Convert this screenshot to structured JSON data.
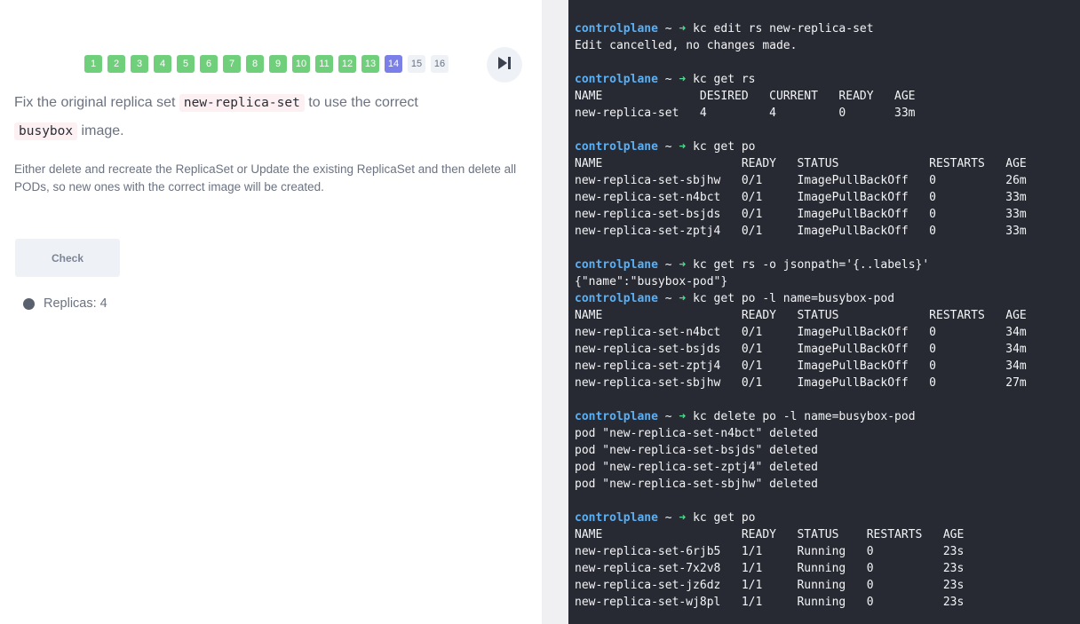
{
  "steps": [
    {
      "label": "1",
      "state": "done"
    },
    {
      "label": "2",
      "state": "done"
    },
    {
      "label": "3",
      "state": "done"
    },
    {
      "label": "4",
      "state": "done"
    },
    {
      "label": "5",
      "state": "done"
    },
    {
      "label": "6",
      "state": "done"
    },
    {
      "label": "7",
      "state": "done"
    },
    {
      "label": "8",
      "state": "done"
    },
    {
      "label": "9",
      "state": "done"
    },
    {
      "label": "10",
      "state": "done"
    },
    {
      "label": "11",
      "state": "done"
    },
    {
      "label": "12",
      "state": "done"
    },
    {
      "label": "13",
      "state": "done"
    },
    {
      "label": "14",
      "state": "current"
    },
    {
      "label": "15",
      "state": "todo"
    },
    {
      "label": "16",
      "state": "todo"
    }
  ],
  "question": {
    "p1_before": "Fix the original replica set ",
    "p1_code1": "new-replica-set",
    "p1_middle": " to use the correct ",
    "p1_code2": "busybox",
    "p1_after": " image.",
    "p2": "Either delete and recreate the ReplicaSet or Update the existing ReplicaSet and then delete all PODs, so new ones with the correct image will be created."
  },
  "check_label": "Check",
  "status": {
    "label": "Replicas: 4"
  },
  "colors": {
    "done": "#6fcf7b",
    "current": "#7b7fe8",
    "terminal_bg": "#272a33",
    "prompt": "#5ab0f5",
    "arrow": "#48e08a"
  },
  "terminal": {
    "lines": [
      {
        "type": "cmd",
        "prompt": "controlplane",
        "cmd": "kc edit rs new-replica-set"
      },
      {
        "type": "out",
        "text": "Edit cancelled, no changes made."
      },
      {
        "type": "blank"
      },
      {
        "type": "cmd",
        "prompt": "controlplane",
        "cmd": "kc get rs"
      },
      {
        "type": "out",
        "text": "NAME              DESIRED   CURRENT   READY   AGE"
      },
      {
        "type": "out",
        "text": "new-replica-set   4         4         0       33m"
      },
      {
        "type": "blank"
      },
      {
        "type": "cmd",
        "prompt": "controlplane",
        "cmd": "kc get po"
      },
      {
        "type": "out",
        "text": "NAME                    READY   STATUS             RESTARTS   AGE"
      },
      {
        "type": "out",
        "text": "new-replica-set-sbjhw   0/1     ImagePullBackOff   0          26m"
      },
      {
        "type": "out",
        "text": "new-replica-set-n4bct   0/1     ImagePullBackOff   0          33m"
      },
      {
        "type": "out",
        "text": "new-replica-set-bsjds   0/1     ImagePullBackOff   0          33m"
      },
      {
        "type": "out",
        "text": "new-replica-set-zptj4   0/1     ImagePullBackOff   0          33m"
      },
      {
        "type": "blank"
      },
      {
        "type": "cmd",
        "prompt": "controlplane",
        "cmd": "kc get rs -o jsonpath='{..labels}'"
      },
      {
        "type": "out",
        "text": "{\"name\":\"busybox-pod\"}"
      },
      {
        "type": "cmd",
        "prompt": "controlplane",
        "cmd": "kc get po -l name=busybox-pod"
      },
      {
        "type": "out",
        "text": "NAME                    READY   STATUS             RESTARTS   AGE"
      },
      {
        "type": "out",
        "text": "new-replica-set-n4bct   0/1     ImagePullBackOff   0          34m"
      },
      {
        "type": "out",
        "text": "new-replica-set-bsjds   0/1     ImagePullBackOff   0          34m"
      },
      {
        "type": "out",
        "text": "new-replica-set-zptj4   0/1     ImagePullBackOff   0          34m"
      },
      {
        "type": "out",
        "text": "new-replica-set-sbjhw   0/1     ImagePullBackOff   0          27m"
      },
      {
        "type": "blank"
      },
      {
        "type": "cmd",
        "prompt": "controlplane",
        "cmd": "kc delete po -l name=busybox-pod"
      },
      {
        "type": "out",
        "text": "pod \"new-replica-set-n4bct\" deleted"
      },
      {
        "type": "out",
        "text": "pod \"new-replica-set-bsjds\" deleted"
      },
      {
        "type": "out",
        "text": "pod \"new-replica-set-zptj4\" deleted"
      },
      {
        "type": "out",
        "text": "pod \"new-replica-set-sbjhw\" deleted"
      },
      {
        "type": "blank"
      },
      {
        "type": "cmd",
        "prompt": "controlplane",
        "cmd": "kc get po"
      },
      {
        "type": "out",
        "text": "NAME                    READY   STATUS    RESTARTS   AGE"
      },
      {
        "type": "out",
        "text": "new-replica-set-6rjb5   1/1     Running   0          23s"
      },
      {
        "type": "out",
        "text": "new-replica-set-7x2v8   1/1     Running   0          23s"
      },
      {
        "type": "out",
        "text": "new-replica-set-jz6dz   1/1     Running   0          23s"
      },
      {
        "type": "out",
        "text": "new-replica-set-wj8pl   1/1     Running   0          23s"
      }
    ]
  }
}
